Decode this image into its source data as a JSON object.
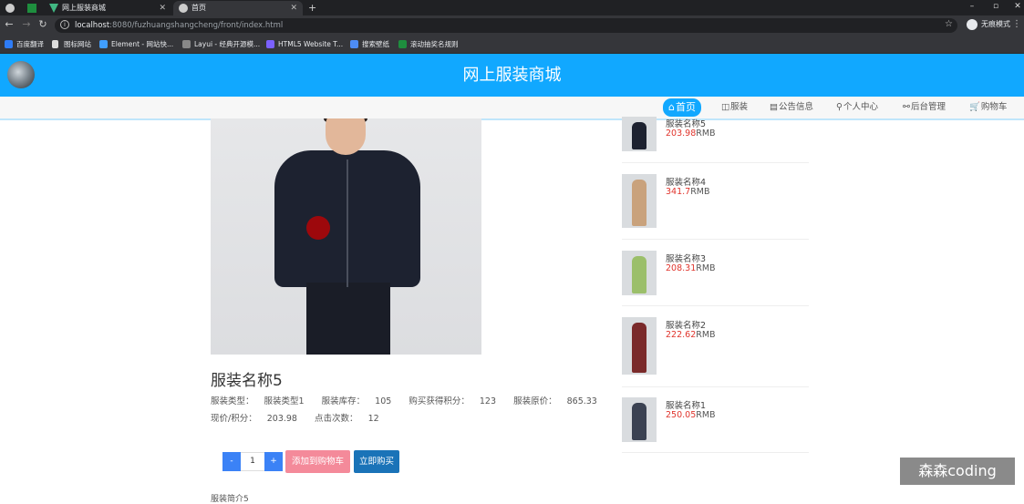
{
  "browser": {
    "tabs": [
      {
        "title": "",
        "active": false
      },
      {
        "title": "",
        "active": false
      },
      {
        "title": "网上服装商城",
        "active": false
      },
      {
        "title": "首页",
        "active": true
      }
    ],
    "url_host": "localhost",
    "url_path": ":8080/fuzhuangshangcheng/front/index.html",
    "incognito_label": "无痕模式",
    "bookmarks": [
      "百度翻译",
      "图标网站",
      "Element - 网站快...",
      "Layui - 经典开源模...",
      "HTML5 Website T...",
      "搜索壁纸",
      "滚动抽奖名规则"
    ]
  },
  "header": {
    "title": "网上服装商城"
  },
  "nav": {
    "items": [
      {
        "icon": "home-icon",
        "glyph": "⌂",
        "label": "首页",
        "active": true
      },
      {
        "icon": "clothing-icon",
        "glyph": "◫",
        "label": "服装",
        "active": false
      },
      {
        "icon": "notice-icon",
        "glyph": "▤",
        "label": "公告信息",
        "active": false
      },
      {
        "icon": "user-icon",
        "glyph": "⚲",
        "label": "个人中心",
        "active": false
      },
      {
        "icon": "link-icon",
        "glyph": "⚯",
        "label": "后台管理",
        "active": false
      },
      {
        "icon": "cart-icon",
        "glyph": "🛒",
        "label": "购物车",
        "active": false
      }
    ]
  },
  "product": {
    "name": "服装名称5",
    "type_label": "服装类型：",
    "type_value": "服装类型1",
    "stock_label": "服装库存：",
    "stock_value": "105",
    "points_label": "购买获得积分：",
    "points_value": "123",
    "orig_label": "服装原价：",
    "orig_value": "865.33",
    "price_label": "现价/积分：",
    "price_value": "203.98",
    "clicks_label": "点击次数：",
    "clicks_value": "12",
    "qty_minus": "-",
    "qty": "1",
    "qty_plus": "+",
    "add_cart_label": "添加到购物车",
    "buy_now_label": "立即购买",
    "intro_label": "服装简介5"
  },
  "sidebar": {
    "currency": "RMB",
    "items": [
      {
        "name": "服装名称5",
        "price": "203.98"
      },
      {
        "name": "服装名称4",
        "price": "341.7"
      },
      {
        "name": "服装名称3",
        "price": "208.31"
      },
      {
        "name": "服装名称2",
        "price": "222.62"
      },
      {
        "name": "服装名称1",
        "price": "250.05"
      }
    ]
  },
  "watermark": "森森coding"
}
